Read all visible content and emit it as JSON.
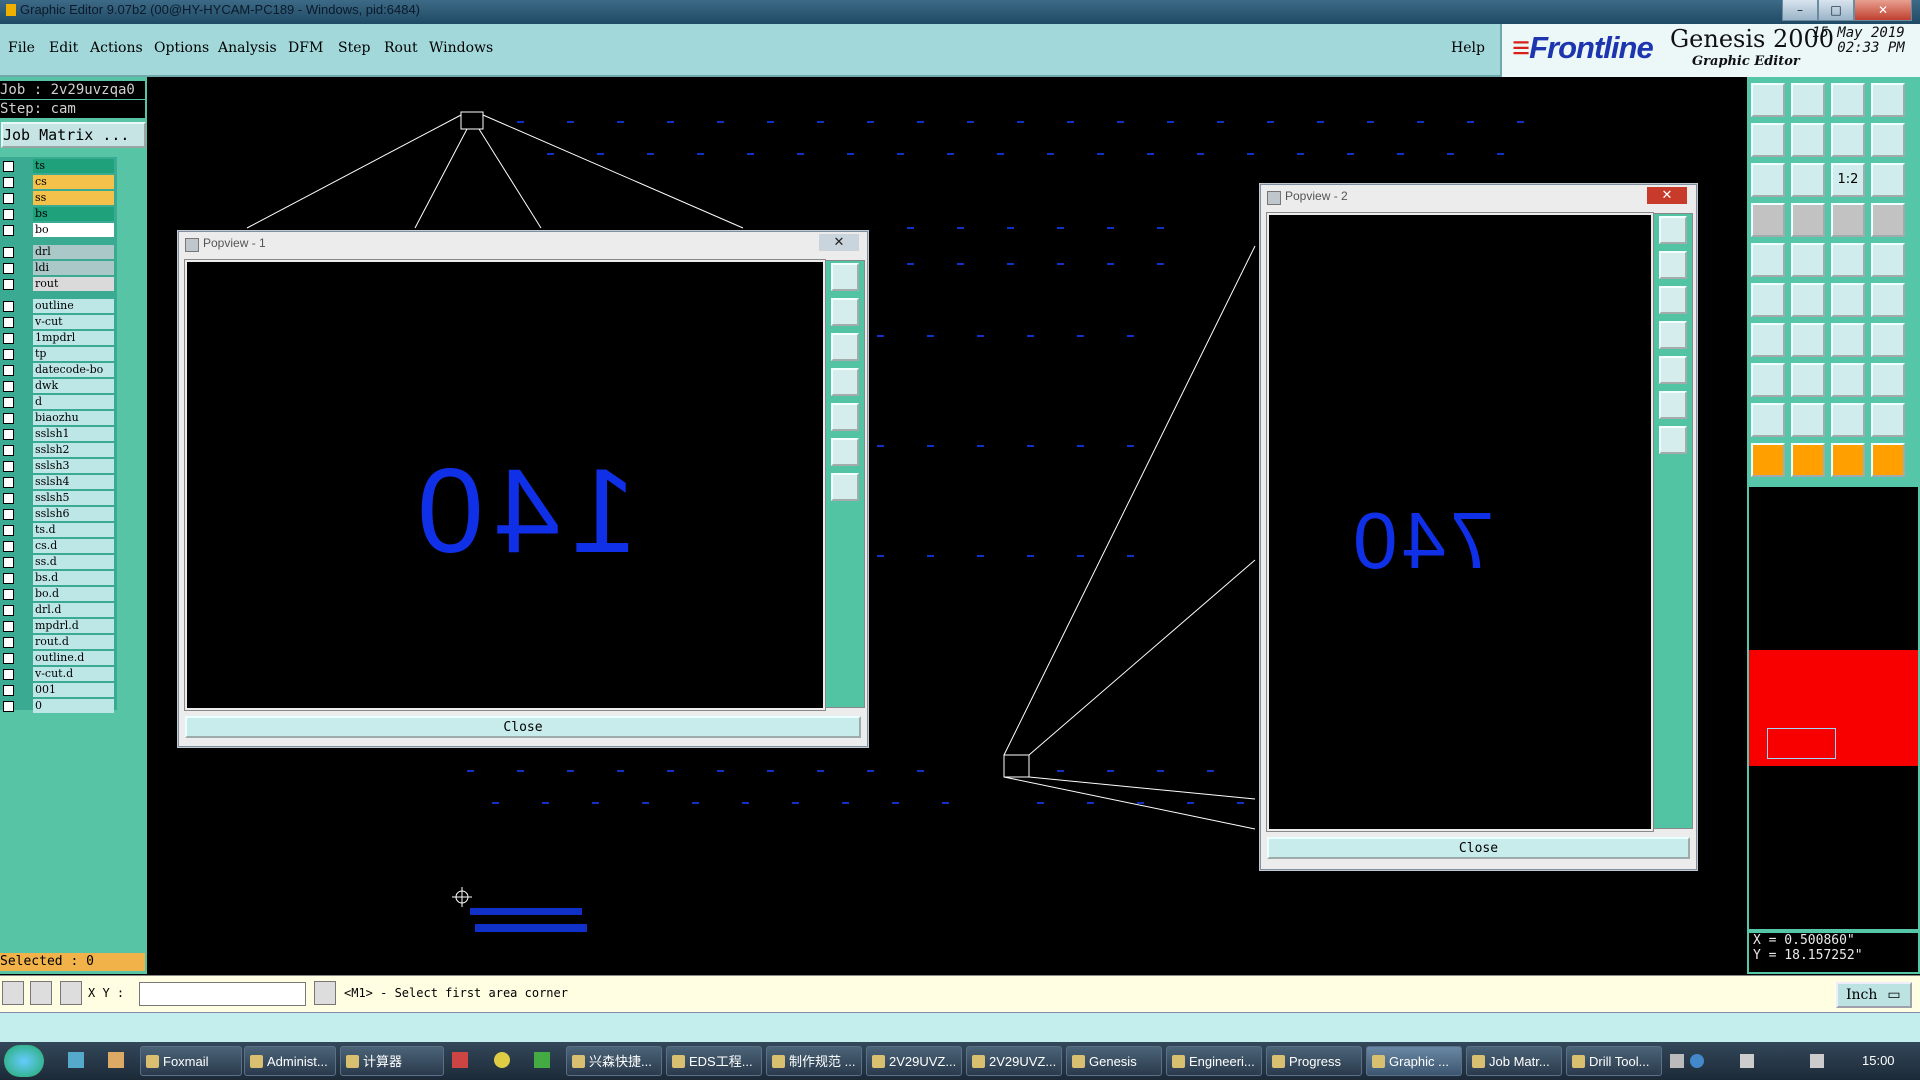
{
  "window": {
    "title": "Graphic Editor 9.07b2 (00@HY-HYCAM-PC189 - Windows, pid:6484)"
  },
  "menu": [
    {
      "label": "File"
    },
    {
      "label": "Edit"
    },
    {
      "label": "Actions"
    },
    {
      "label": "Options"
    },
    {
      "label": "Analysis"
    },
    {
      "label": "DFM"
    },
    {
      "label": "Step"
    },
    {
      "label": "Rout"
    },
    {
      "label": "Windows"
    }
  ],
  "help_label": "Help",
  "brand": {
    "logo": "Frontline",
    "product": "Genesis 2000",
    "date": "15 May 2019",
    "time": "02:33 PM",
    "subtitle": "Graphic Editor"
  },
  "job": {
    "job_line": "Job : 2v29uvzqa0",
    "step_line": "Step: cam",
    "matrix_button": "Job Matrix ..."
  },
  "layers": [
    {
      "name": "ts",
      "color": "#1fa27c"
    },
    {
      "name": "cs",
      "color": "#f4c24a"
    },
    {
      "name": "ss",
      "color": "#f4c24a"
    },
    {
      "name": "bs",
      "color": "#1fa27c"
    },
    {
      "name": "bo",
      "color": "#ffffff"
    },
    {
      "name": "drl",
      "color": "#aac8c8"
    },
    {
      "name": "ldi",
      "color": "#aac8c8"
    },
    {
      "name": "rout",
      "color": "#dadada"
    },
    {
      "name": "outline",
      "color": "#bde6e6"
    },
    {
      "name": "v-cut",
      "color": "#bde6e6"
    },
    {
      "name": "1mpdrl",
      "color": "#bde6e6"
    },
    {
      "name": "tp",
      "color": "#bde6e6"
    },
    {
      "name": "datecode-bo",
      "color": "#bde6e6"
    },
    {
      "name": "dwk",
      "color": "#bde6e6"
    },
    {
      "name": "d",
      "color": "#bde6e6"
    },
    {
      "name": "biaozhu",
      "color": "#bde6e6"
    },
    {
      "name": "sslsh1",
      "color": "#bde6e6"
    },
    {
      "name": "sslsh2",
      "color": "#bde6e6"
    },
    {
      "name": "sslsh3",
      "color": "#bde6e6"
    },
    {
      "name": "sslsh4",
      "color": "#bde6e6"
    },
    {
      "name": "sslsh5",
      "color": "#bde6e6"
    },
    {
      "name": "sslsh6",
      "color": "#bde6e6"
    },
    {
      "name": "ts.d",
      "color": "#bde6e6"
    },
    {
      "name": "cs.d",
      "color": "#bde6e6"
    },
    {
      "name": "ss.d",
      "color": "#bde6e6"
    },
    {
      "name": "bs.d",
      "color": "#bde6e6"
    },
    {
      "name": "bo.d",
      "color": "#bde6e6"
    },
    {
      "name": "drl.d",
      "color": "#bde6e6"
    },
    {
      "name": "mpdrl.d",
      "color": "#bde6e6"
    },
    {
      "name": "rout.d",
      "color": "#bde6e6"
    },
    {
      "name": "outline.d",
      "color": "#bde6e6"
    },
    {
      "name": "v-cut.d",
      "color": "#bde6e6"
    },
    {
      "name": "001",
      "color": "#bde6e6"
    },
    {
      "name": "0",
      "color": "#bde6e6"
    }
  ],
  "selected": "Selected : 0",
  "popview1": {
    "title": "Popview - 1",
    "text": "140",
    "close": "Close"
  },
  "popview2": {
    "title": "Popview - 2",
    "text": "740",
    "close": "Close"
  },
  "coords": {
    "x": "X = 0.500860\"",
    "y": "Y = 18.157252\""
  },
  "status": {
    "xy_label": "X Y :",
    "prompt": "<M1> - Select first area corner",
    "unit": "Inch"
  },
  "taskbar": [
    {
      "label": "Foxmail"
    },
    {
      "label": "Administ..."
    },
    {
      "label": "计算器"
    },
    {
      "label": "兴森快捷..."
    },
    {
      "label": "EDS工程..."
    },
    {
      "label": "制作规范 ..."
    },
    {
      "label": "2V29UVZ..."
    },
    {
      "label": "2V29UVZ..."
    },
    {
      "label": "Genesis"
    },
    {
      "label": "Engineeri..."
    },
    {
      "label": "Progress"
    },
    {
      "label": "Graphic ..."
    },
    {
      "label": "Job Matr..."
    },
    {
      "label": "Drill Tool..."
    }
  ],
  "clock": "15:00"
}
